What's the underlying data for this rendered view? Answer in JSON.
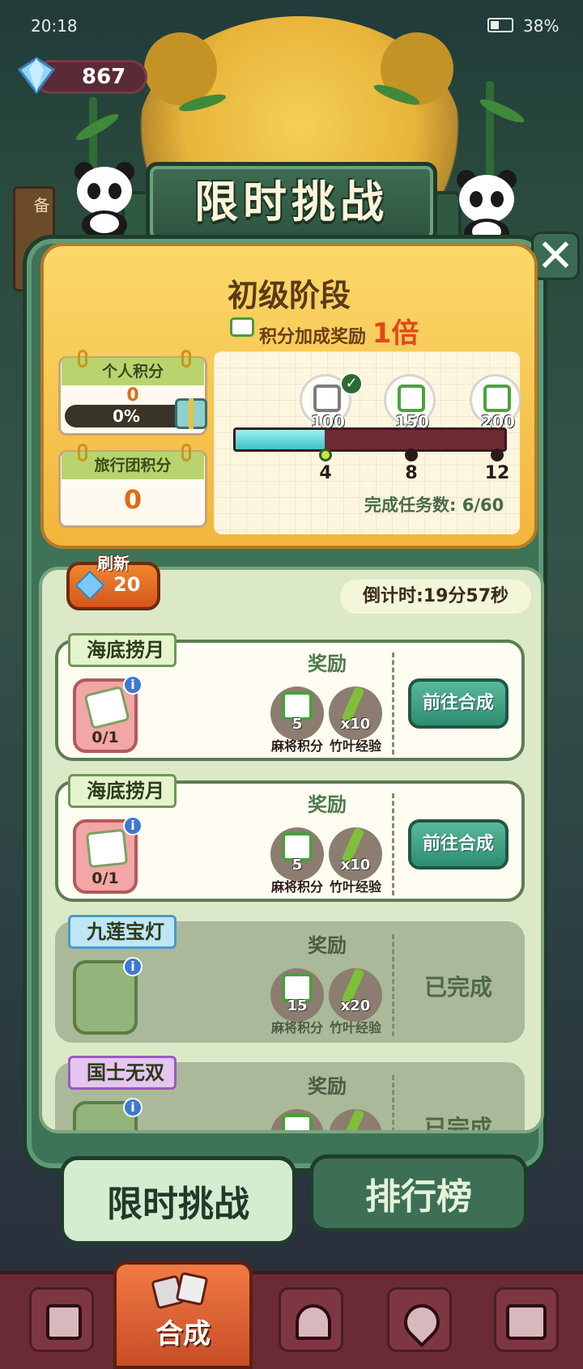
{
  "status": {
    "time": "20:18",
    "battery": "38%"
  },
  "currency": {
    "gems": "867"
  },
  "side_banner": "备",
  "title": "限时挑战",
  "stage": {
    "name": "初级阶段",
    "bonus_label": "积分加成奖励",
    "bonus_multiplier": "1倍",
    "personal_score": {
      "label": "个人积分",
      "value": "0",
      "percent": "0%"
    },
    "group_score": {
      "label": "旅行团积分",
      "value": "0"
    },
    "milestones": [
      {
        "points": "100",
        "tasks": "4",
        "claimed": true
      },
      {
        "points": "150",
        "tasks": "8",
        "claimed": false
      },
      {
        "points": "200",
        "tasks": "12",
        "claimed": false
      }
    ],
    "progress_fraction": 0.33,
    "tasks_done_label": "完成任务数:",
    "tasks_done": "6/60"
  },
  "refresh": {
    "label": "刷新",
    "cost": "20"
  },
  "countdown": "倒计时:19分57秒",
  "tasks": [
    {
      "name": "海底捞月",
      "progress": "0/1",
      "reward_title": "奖励",
      "rewards": [
        {
          "value": "5",
          "label": "麻将积分"
        },
        {
          "value": "x10",
          "label": "竹叶经验"
        }
      ],
      "action": "前往合成",
      "done": false,
      "tag_color": "green"
    },
    {
      "name": "海底捞月",
      "progress": "0/1",
      "reward_title": "奖励",
      "rewards": [
        {
          "value": "5",
          "label": "麻将积分"
        },
        {
          "value": "x10",
          "label": "竹叶经验"
        }
      ],
      "action": "前往合成",
      "done": false,
      "tag_color": "green"
    },
    {
      "name": "九莲宝灯",
      "progress": "",
      "reward_title": "奖励",
      "rewards": [
        {
          "value": "15",
          "label": "麻将积分"
        },
        {
          "value": "x20",
          "label": "竹叶经验"
        }
      ],
      "action": "已完成",
      "done": true,
      "tag_color": "blue"
    },
    {
      "name": "国士无双",
      "progress": "",
      "reward_title": "奖励",
      "rewards": [
        {
          "value": "",
          "label": ""
        },
        {
          "value": "",
          "label": ""
        }
      ],
      "action": "已完成",
      "done": true,
      "tag_color": "purple"
    }
  ],
  "tabs": {
    "active": "限时挑战",
    "inactive": "排行榜"
  },
  "nav": {
    "center_label": "合成",
    "items": [
      "shop-bag-icon",
      "merge-icon",
      "service-bell-icon",
      "map-pin-icon",
      "bus-icon"
    ]
  }
}
